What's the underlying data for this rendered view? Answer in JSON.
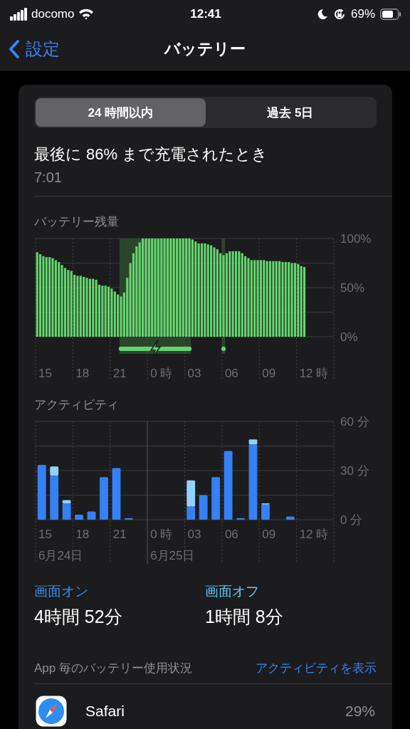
{
  "status_bar": {
    "carrier": "docomo",
    "time": "12:41",
    "battery": "69%"
  },
  "nav": {
    "back": "設定",
    "title": "バッテリー"
  },
  "segments": [
    {
      "label": "24 時間以内",
      "selected": true
    },
    {
      "label": "過去 5日",
      "selected": false
    }
  ],
  "last_charge": {
    "title": "最後に 86% まで充電されたとき",
    "time": "7:01"
  },
  "battery_chart": {
    "x_labels": [
      {
        "label": "15"
      },
      {
        "label": "18"
      },
      {
        "label": "21"
      },
      {
        "label": "0 時"
      },
      {
        "label": "03"
      },
      {
        "label": "06"
      },
      {
        "label": "09"
      },
      {
        "label": "12 時"
      }
    ],
    "chart_data": {
      "type": "bar",
      "title": "バッテリー残量",
      "ylim": [
        0,
        100
      ],
      "yticks": [
        {
          "value": 0,
          "label": "0%"
        },
        {
          "value": 50,
          "label": "50%"
        },
        {
          "value": 100,
          "label": "100%"
        }
      ],
      "values": [
        86,
        84,
        82,
        81,
        81,
        80,
        78,
        76,
        73,
        70,
        68,
        67,
        63,
        62,
        62,
        61,
        60,
        59,
        59,
        58,
        53,
        52,
        52,
        51,
        49,
        46,
        43,
        41,
        45,
        60,
        75,
        85,
        92,
        96,
        100,
        100,
        100,
        100,
        100,
        100,
        100,
        100,
        100,
        100,
        100,
        100,
        100,
        100,
        100,
        100,
        99,
        97,
        95,
        95,
        95,
        94,
        93,
        91,
        89,
        85,
        83,
        85,
        87,
        87,
        87,
        87,
        85,
        82,
        80,
        78,
        78,
        78,
        78,
        78,
        77,
        77,
        77,
        77,
        77,
        76,
        76,
        76,
        75,
        75,
        74,
        72,
        71,
        null,
        null,
        null,
        null,
        null,
        null,
        null,
        null,
        null
      ]
    }
  },
  "activity_chart": {
    "x_labels": [
      {
        "label": "15"
      },
      {
        "label": "18"
      },
      {
        "label": "21"
      },
      {
        "label": "0 時"
      },
      {
        "label": "03"
      },
      {
        "label": "06"
      },
      {
        "label": "09"
      },
      {
        "label": "12 時"
      }
    ],
    "dates": [
      "6月24日",
      "6月25日"
    ],
    "chart_data": {
      "type": "bar",
      "stacked": true,
      "title": "アクティビティ",
      "ylim": [
        0,
        60
      ],
      "yticks": [
        {
          "value": 0,
          "label": "0 分"
        },
        {
          "value": 30,
          "label": "30 分"
        },
        {
          "value": 60,
          "label": "60 分"
        }
      ],
      "series": [
        {
          "color": "#3680f5",
          "values": [
            33.5,
            27,
            10,
            3,
            5,
            26,
            31.5,
            1,
            0,
            0,
            0,
            0,
            8,
            15,
            26,
            42,
            1,
            46,
            9.5,
            0,
            2,
            null,
            null,
            null
          ]
        },
        {
          "color": "#8fd2ff",
          "values": [
            0,
            5.5,
            2,
            0,
            0,
            0,
            0,
            0,
            0,
            0,
            0,
            0,
            16,
            0,
            0,
            0,
            0,
            3,
            0.5,
            0,
            0,
            null,
            null,
            null
          ]
        }
      ]
    }
  },
  "screen": [
    {
      "label": "画面オン",
      "value": "4時間 52分",
      "color": "#3a8ef0"
    },
    {
      "label": "画面オフ",
      "value": "1時間 8分",
      "color": "#66c6f5"
    }
  ],
  "usage_header": {
    "title": "App 毎のバッテリー使用状況",
    "link": "アクティビティを表示"
  },
  "apps": [
    {
      "name": "Safari",
      "percent": "29%"
    }
  ]
}
